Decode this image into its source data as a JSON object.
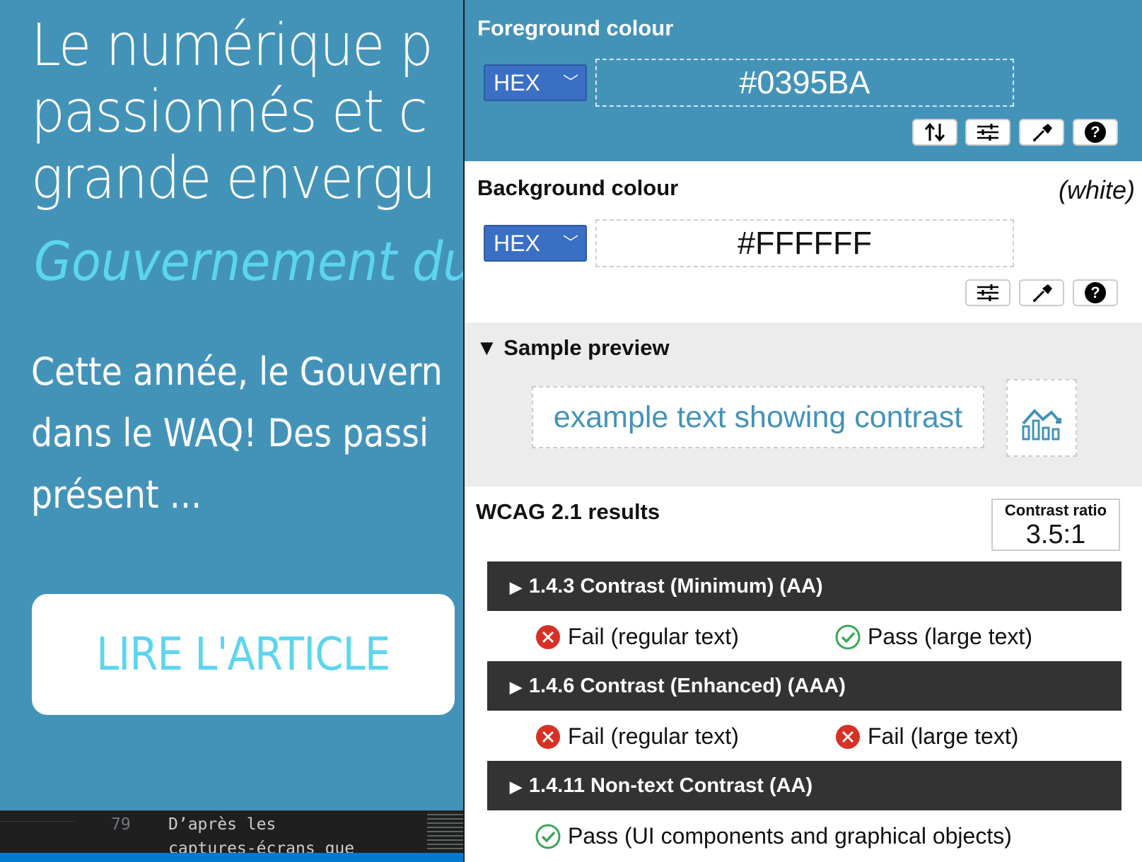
{
  "webpage": {
    "title_lines": [
      "Le numérique p",
      "passionnés et c",
      "grande envergu"
    ],
    "subtitle": "Gouvernement du",
    "body_lines": [
      "Cette année, le Gouvern",
      "dans le WAQ! Des passi",
      "présent ..."
    ],
    "cta_label": "LIRE L'ARTICLE"
  },
  "editor": {
    "line_number": "79",
    "line_text": "D’après les",
    "next_line_text": "captures-écrans que"
  },
  "panel": {
    "foreground": {
      "title": "Foreground colour",
      "format": "HEX",
      "value": "#0395BA"
    },
    "background": {
      "title": "Background colour",
      "colour_name": "(white)",
      "format": "HEX",
      "value": "#FFFFFF"
    },
    "preview": {
      "title": "▼ Sample preview",
      "sample_text": "example text showing contrast"
    },
    "results": {
      "title": "WCAG 2.1 results",
      "ratio_label": "Contrast ratio",
      "ratio_value": "3.5:1",
      "criteria": [
        {
          "label": "1.4.3 Contrast (Minimum) (AA)",
          "results": [
            {
              "status": "fail",
              "text": "Fail (regular text)"
            },
            {
              "status": "pass",
              "text": "Pass (large text)"
            }
          ]
        },
        {
          "label": "1.4.6 Contrast (Enhanced) (AAA)",
          "results": [
            {
              "status": "fail",
              "text": "Fail (regular text)"
            },
            {
              "status": "fail",
              "text": "Fail (large text)"
            }
          ]
        },
        {
          "label": "1.4.11 Non-text Contrast (AA)",
          "results": [
            {
              "status": "pass",
              "text": "Pass (UI components and graphical objects)"
            }
          ]
        }
      ]
    },
    "colors": {
      "foreground": "#4393b9",
      "pass": "#3aa757",
      "fail": "#d93025",
      "bar": "#333333"
    }
  }
}
